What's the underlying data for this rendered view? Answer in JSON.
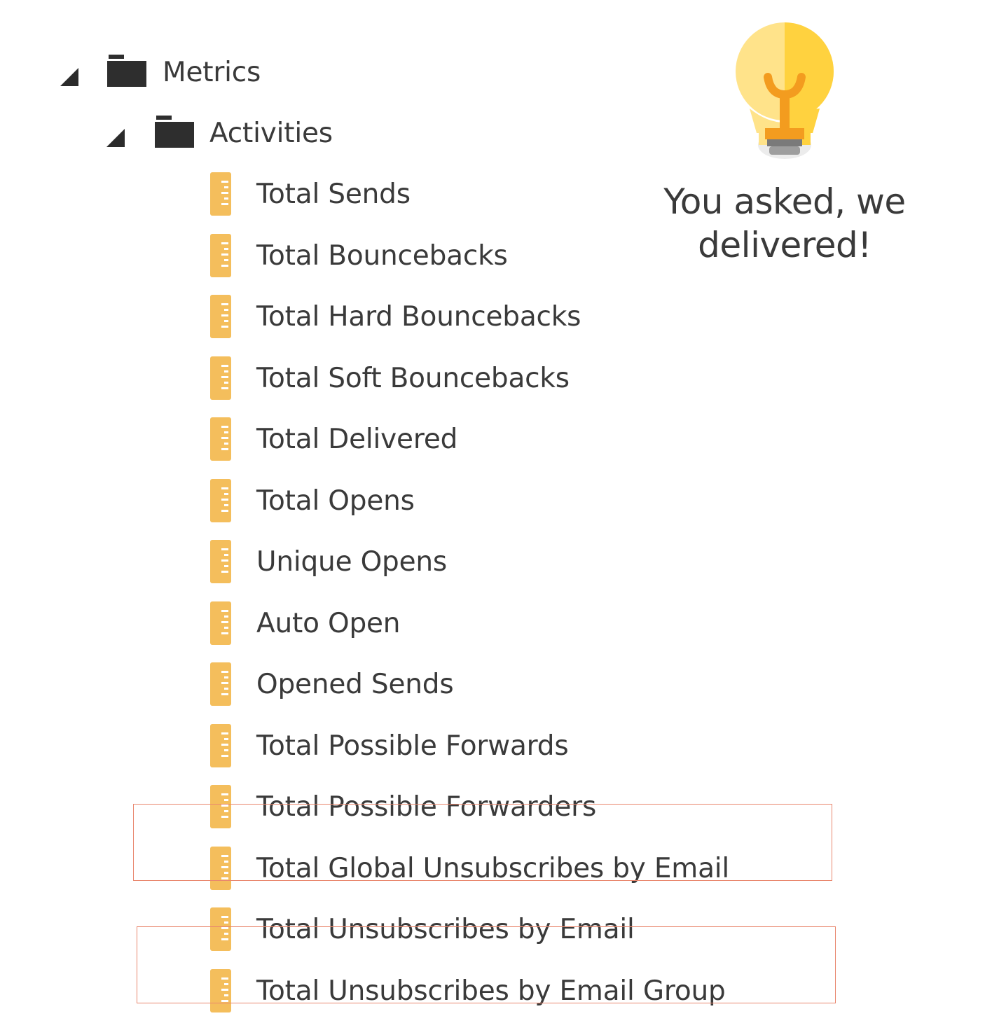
{
  "tree": {
    "root": {
      "label": "Metrics",
      "expanded_icon": "triangle-expanded-icon",
      "icon": "folder-icon",
      "child": {
        "label": "Activities",
        "expanded_icon": "triangle-expanded-icon",
        "icon": "folder-icon",
        "items": [
          {
            "label": "Total Sends",
            "icon": "measure-ruler-icon",
            "highlighted": false
          },
          {
            "label": "Total Bouncebacks",
            "icon": "measure-ruler-icon",
            "highlighted": false
          },
          {
            "label": "Total Hard Bouncebacks",
            "icon": "measure-ruler-icon",
            "highlighted": false
          },
          {
            "label": "Total Soft Bouncebacks",
            "icon": "measure-ruler-icon",
            "highlighted": false
          },
          {
            "label": "Total Delivered",
            "icon": "measure-ruler-icon",
            "highlighted": false
          },
          {
            "label": "Total Opens",
            "icon": "measure-ruler-icon",
            "highlighted": false
          },
          {
            "label": "Unique Opens",
            "icon": "measure-ruler-icon",
            "highlighted": false
          },
          {
            "label": "Auto Open",
            "icon": "measure-ruler-icon",
            "highlighted": false
          },
          {
            "label": "Opened Sends",
            "icon": "measure-ruler-icon",
            "highlighted": false
          },
          {
            "label": "Total Possible Forwards",
            "icon": "measure-ruler-icon",
            "highlighted": false
          },
          {
            "label": "Total Possible Forwarders",
            "icon": "measure-ruler-icon",
            "highlighted": false
          },
          {
            "label": "Total Global Unsubscribes by Email",
            "icon": "measure-ruler-icon",
            "highlighted": true
          },
          {
            "label": "Total Unsubscribes by Email",
            "icon": "measure-ruler-icon",
            "highlighted": false
          },
          {
            "label": "Total Unsubscribes by Email Group",
            "icon": "measure-ruler-icon",
            "highlighted": true
          }
        ]
      }
    }
  },
  "callout": {
    "icon": "lightbulb-icon",
    "text_line1": "You asked, we",
    "text_line2": "delivered!"
  },
  "colors": {
    "folder": "#2e2e2e",
    "ruler": "#f4be5c",
    "highlight_border": "#e9876e",
    "bulb_light": "#ffe38a",
    "bulb_dark": "#ffd23f",
    "bulb_filament": "#f39c1f",
    "bulb_base": "#8c8c8c"
  }
}
